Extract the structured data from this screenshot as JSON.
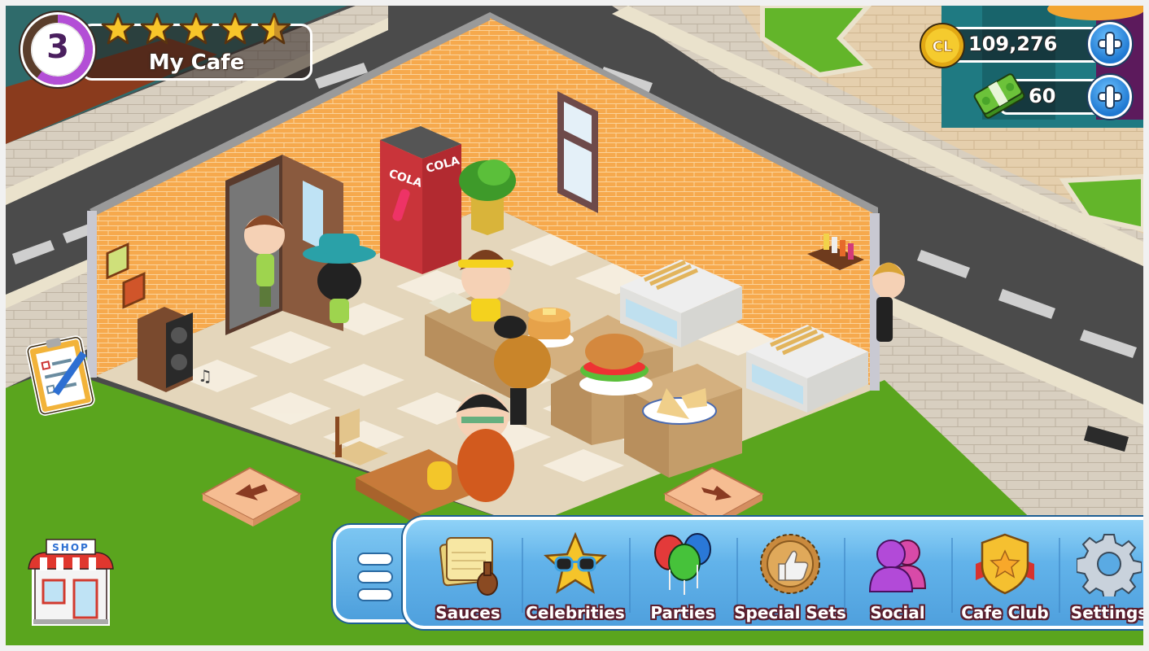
{
  "header": {
    "level": "3",
    "level_progress_fraction": 0.6,
    "cafe_name": "My Cafe",
    "stars_rating": 4.5,
    "stars_max": 5
  },
  "currency": {
    "coins": {
      "icon": "cl-coin-icon",
      "value": "109,276",
      "add_label": "+"
    },
    "cash": {
      "icon": "cash-stack-icon",
      "value": "60",
      "add_label": "+"
    }
  },
  "menu": {
    "toggle_icon": "hamburger-icon",
    "items": [
      {
        "id": "sauces",
        "label": "Sauces",
        "icon": "recipe-pepper-mill-icon"
      },
      {
        "id": "celebrities",
        "label": "Celebrities",
        "icon": "star-sunglasses-icon"
      },
      {
        "id": "parties",
        "label": "Parties",
        "icon": "balloons-icon"
      },
      {
        "id": "special-sets",
        "label": "Special Sets",
        "icon": "thumbs-up-medal-icon"
      },
      {
        "id": "social",
        "label": "Social",
        "icon": "people-icon"
      },
      {
        "id": "cafe-club",
        "label": "Cafe Club",
        "icon": "shield-star-icon"
      },
      {
        "id": "settings",
        "label": "Settings",
        "icon": "gear-icon"
      }
    ]
  },
  "side": {
    "shop_sign": "SHOP",
    "tasks_icon": "clipboard-pencil-icon"
  },
  "scene": {
    "vending_machine_label": "COLA",
    "arrows": [
      "down-left",
      "down-right"
    ]
  },
  "colors": {
    "wall": "#f6a94d",
    "floor": "#e9dcc3",
    "floor_tile": "#f4ecdc",
    "grass": "#5aa51e",
    "road": "#4b4b4b",
    "menu_blue": "#5aaae3",
    "level_purple": "#b34fd6",
    "plus_blue": "#1f78d1",
    "coin_gold": "#f3c21f"
  }
}
